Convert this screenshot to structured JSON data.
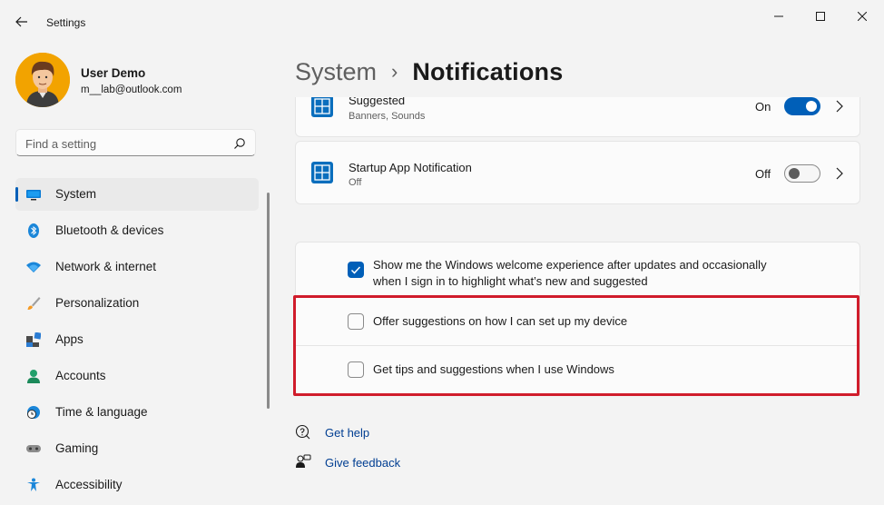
{
  "window": {
    "title": "Settings",
    "back_icon": "arrow-left-icon",
    "controls": [
      "minimize-icon",
      "maximize-icon",
      "close-icon"
    ]
  },
  "profile": {
    "name": "User Demo",
    "email": "m__lab@outlook.com"
  },
  "search": {
    "placeholder": "Find a setting",
    "icon": "search-icon"
  },
  "nav": {
    "items": [
      {
        "label": "System",
        "icon": "system-icon",
        "active": true
      },
      {
        "label": "Bluetooth & devices",
        "icon": "bluetooth-icon"
      },
      {
        "label": "Network & internet",
        "icon": "wifi-icon"
      },
      {
        "label": "Personalization",
        "icon": "brush-icon"
      },
      {
        "label": "Apps",
        "icon": "apps-icon"
      },
      {
        "label": "Accounts",
        "icon": "accounts-icon"
      },
      {
        "label": "Time & language",
        "icon": "globe-clock-icon"
      },
      {
        "label": "Gaming",
        "icon": "gamepad-icon"
      },
      {
        "label": "Accessibility",
        "icon": "accessibility-icon"
      }
    ]
  },
  "breadcrumb": {
    "parent": "System",
    "separator": "›",
    "current": "Notifications"
  },
  "app_cards": [
    {
      "title": "Suggested",
      "subtitle": "Banners, Sounds",
      "state": "On",
      "on": true
    },
    {
      "title": "Startup App Notification",
      "subtitle": "Off",
      "state": "Off",
      "on": false
    }
  ],
  "checkboxes": [
    {
      "line1": "Show me the Windows welcome experience after updates and occasionally",
      "line2": "when I sign in to highlight what’s new and suggested",
      "checked": true
    },
    {
      "line1": "Offer suggestions on how I can set up my device",
      "checked": false
    },
    {
      "line1": "Get tips and suggestions when I use Windows",
      "checked": false
    }
  ],
  "links": {
    "help": "Get help",
    "feedback": "Give feedback"
  },
  "colors": {
    "accent": "#005fb8",
    "highlight_border": "#d01c2b",
    "background": "#f3f3f3"
  }
}
